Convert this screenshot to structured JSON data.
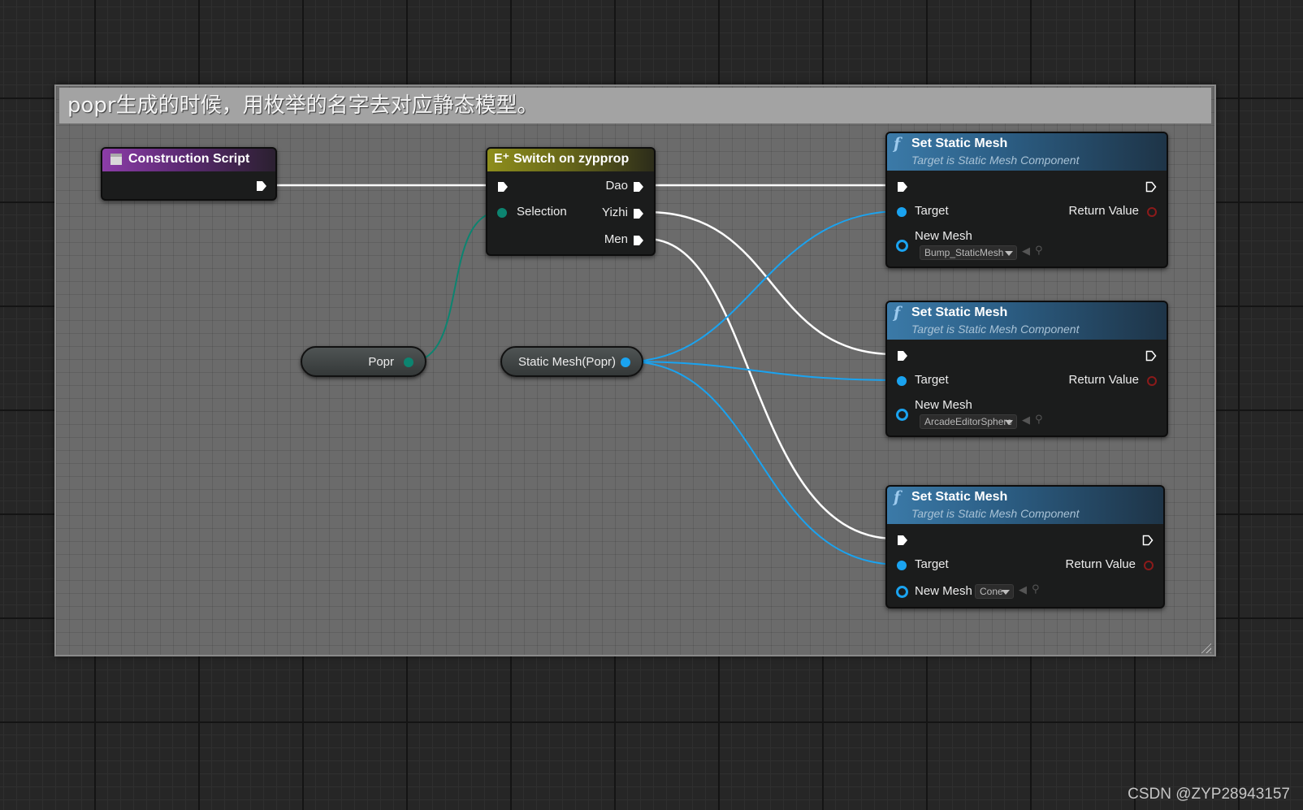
{
  "comment": {
    "title": "popr生成的时候，用枚举的名字去对应静态模型。"
  },
  "construction_script": {
    "title": "Construction Script"
  },
  "switch_node": {
    "title": "Switch on zypprop",
    "selection_label": "Selection",
    "outputs": [
      "Dao",
      "Yizhi",
      "Men"
    ]
  },
  "popr_var": {
    "label": "Popr"
  },
  "static_mesh_var": {
    "label": "Static Mesh(Popr)"
  },
  "set_mesh_nodes": [
    {
      "title": "Set Static Mesh",
      "subtitle": "Target is Static Mesh Component",
      "target_label": "Target",
      "return_label": "Return Value",
      "new_mesh_label": "New Mesh",
      "mesh_value": "Bump_StaticMesh"
    },
    {
      "title": "Set Static Mesh",
      "subtitle": "Target is Static Mesh Component",
      "target_label": "Target",
      "return_label": "Return Value",
      "new_mesh_label": "New Mesh",
      "mesh_value": "ArcadeEditorSphere"
    },
    {
      "title": "Set Static Mesh",
      "subtitle": "Target is Static Mesh Component",
      "target_label": "Target",
      "return_label": "Return Value",
      "new_mesh_label": "New Mesh",
      "mesh_value": "Cone"
    }
  ],
  "watermark": "CSDN @ZYP28943157",
  "colors": {
    "exec_wire": "#ffffff",
    "object_wire": "#1aa3f0",
    "enum_wire": "#0c8470",
    "construction_header": "#8c3da8",
    "switch_header": "#8e8e1c",
    "function_header": "#3b7aa8"
  },
  "icons": {
    "function": "f-function-icon",
    "switch": "switch-enum-icon",
    "construction": "script-icon",
    "reset": "arrow-left-icon",
    "browse": "magnifier-icon"
  }
}
